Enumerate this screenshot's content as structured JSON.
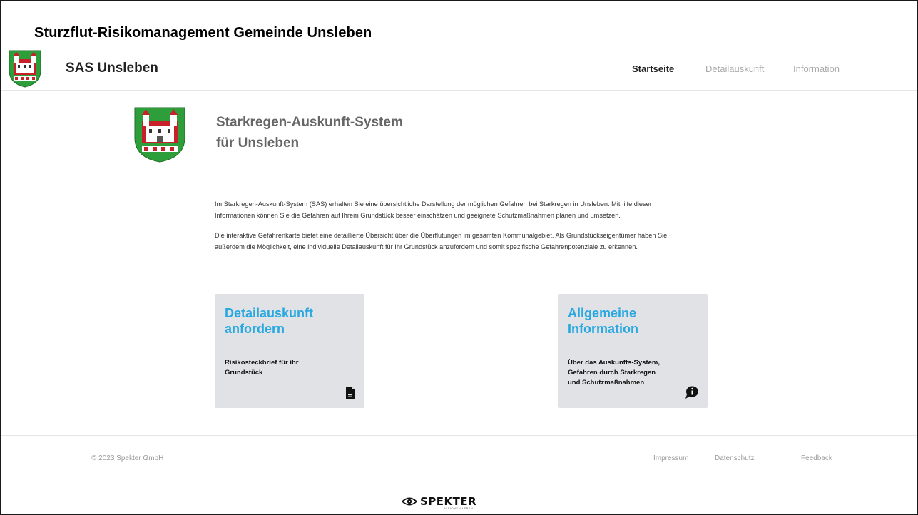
{
  "slide_title": "Sturzflut-Risikomanagement Gemeinde Unsleben",
  "header": {
    "brand": "SAS Unsleben",
    "nav": [
      {
        "label": "Startseite",
        "active": true
      },
      {
        "label": "Detailauskunft",
        "active": false
      },
      {
        "label": "Information",
        "active": false
      }
    ]
  },
  "hero": {
    "title_line1": "Starkregen-Auskunft-System",
    "title_line2": "für Unsleben"
  },
  "paragraphs": [
    {
      "line1": "Im Starkregen-Auskunft-System (SAS) erhalten Sie eine übersichtliche Darstellung der möglichen Gefahren bei Starkregen in Unsleben. Mithilfe dieser",
      "line2": "Informationen können Sie die Gefahren auf Ihrem Grundstück besser einschätzen und geeignete Schutzmaßnahmen planen und umsetzen."
    },
    {
      "line1": "Die interaktive Gefahrenkarte bietet eine detaillierte Übersicht über die Überflutungen im gesamten Kommunalgebiet. Als Grundstückseigentümer haben Sie",
      "line2": "außerdem die Möglichkeit, eine individuelle Detailauskunft für Ihr Grundstück anzufordern und somit spezifische Gefahrenpotenziale zu erkennen."
    }
  ],
  "cards": [
    {
      "title_line1": "Detailauskunft",
      "title_line2": "anfordern",
      "text_line1": "Risikosteckbrief für ihr",
      "text_line2": "Grundstück",
      "text_line3": "",
      "icon": "document-icon"
    },
    {
      "title_line1": "Allgemeine",
      "title_line2": "Information",
      "text_line1": "Über das Auskunfts-System,",
      "text_line2": "Gefahren durch Starkregen",
      "text_line3": "und Schutzmaßnahmen",
      "icon": "info-bubble-icon"
    }
  ],
  "footer": {
    "copyright": "© 2023 Spekter GmbH",
    "links": [
      "Impressum",
      "Datenschutz",
      "Feedback"
    ]
  },
  "logo": {
    "word": "SPEKTER",
    "tagline": "VISIONEN LEBEN"
  },
  "colors": {
    "accent": "#29a8e0",
    "card_bg": "#e0e2e6",
    "crest_green": "#2e9e3a",
    "crest_red": "#c8202a"
  }
}
